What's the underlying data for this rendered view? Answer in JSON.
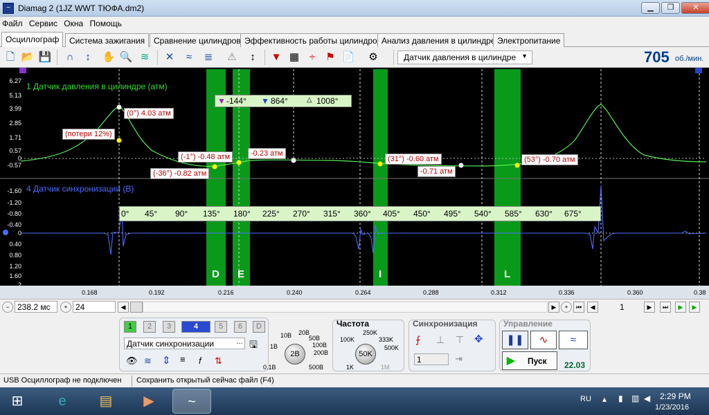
{
  "window": {
    "title": "Diamag 2 (1JZ WWT ТЮФА.dm2)",
    "app_icon": "waveform-icon"
  },
  "menu": [
    "Файл",
    "Сервис",
    "Окна",
    "Помощь"
  ],
  "tabs": [
    "Осциллограф",
    "Система зажигания",
    "Сравнение цилиндров",
    "Эффективность работы цилиндров",
    "Анализ давления в цилиндре",
    "Электропитание"
  ],
  "active_tab": "Осциллограф",
  "toolbar": {
    "sensor_select": "Датчик давления в цилиндре",
    "rpm_value": "705",
    "rpm_unit": "об./мин."
  },
  "channel1": {
    "label": "1 Датчик давления в цилиндре (атм)",
    "color": "#33dd33",
    "yticks": [
      "6.27",
      "5.13",
      "3.99",
      "2.85",
      "1.71",
      "0.57",
      "0",
      "-0.57"
    ]
  },
  "channel4": {
    "label": "4 Датчик синхронизации (В)",
    "color": "#4466ff",
    "yticks": [
      "-1.60",
      "-1.20",
      "-0.80",
      "-0.40",
      "0",
      "0.40",
      "0.80",
      "1.20",
      "1.60",
      "2"
    ]
  },
  "cursors": [
    "-144°",
    "864°",
    "1008°"
  ],
  "callouts": {
    "peak": "(0°) 4.03 атм",
    "loss": "(потери 12%)",
    "c1": "(-1°) -0.48 атм",
    "c2": "(-36°) -0.82 атм",
    "c3": "-0.23 атм",
    "c4": "(31°) -0.60 атм",
    "c5": "-0.71 атм",
    "c6": "(53°) -0.70 атм"
  },
  "angle_ruler": [
    "0°",
    "45°",
    "90°",
    "135°",
    "180°",
    "225°",
    "270°",
    "315°",
    "360°",
    "405°",
    "450°",
    "495°",
    "540°",
    "585°",
    "630°",
    "675°"
  ],
  "zones": [
    "D",
    "E",
    "I",
    "L"
  ],
  "x_axis": [
    "0.168",
    "0.192",
    "0.216",
    "0.240",
    "0.264",
    "0.288",
    "0.312",
    "0.336",
    "0.360",
    "0.38"
  ],
  "scroll": {
    "timebase": "238.2 мс",
    "zoom": "24",
    "page": "1"
  },
  "channel_buttons": [
    "1",
    "2",
    "3",
    "4",
    "5",
    "6",
    "D"
  ],
  "channel_source": "Датчик синхронизации",
  "amplitude": {
    "value": "2В",
    "labels": [
      "10В",
      "20В",
      "50В",
      "100В",
      "200В",
      "500В",
      "0.1В",
      "1В"
    ]
  },
  "frequency": {
    "title": "Частота",
    "value": "50K",
    "labels": [
      "100K",
      "250K",
      "333K",
      "500K",
      "1M",
      "1K"
    ]
  },
  "sync": {
    "title": "Синхронизация",
    "channel": "1"
  },
  "control": {
    "title": "Управление",
    "start_label": "Пуск",
    "value": "22.03"
  },
  "status": {
    "usb": "USB Осциллограф не подключен",
    "save_hint": "Сохранить открытый сейчас файл (F4)"
  },
  "tray": {
    "lang": "RU",
    "time": "2:29 PM",
    "date": "1/23/2016"
  }
}
